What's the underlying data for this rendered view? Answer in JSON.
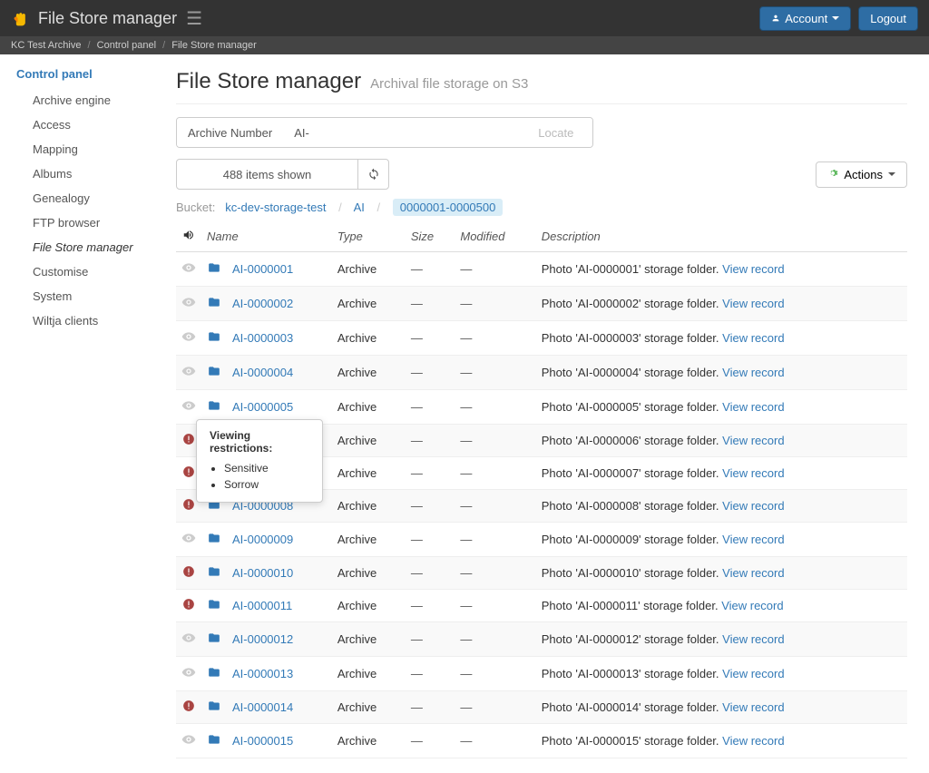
{
  "brand": "File Store manager",
  "nav": {
    "account": "Account",
    "logout": "Logout"
  },
  "breadcrumb": [
    {
      "label": "KC Test Archive"
    },
    {
      "label": "Control panel"
    },
    {
      "label": "File Store manager"
    }
  ],
  "sidebar": {
    "title": "Control panel",
    "items": [
      "Archive engine",
      "Access",
      "Mapping",
      "Albums",
      "Genealogy",
      "FTP browser",
      "File Store manager",
      "Customise",
      "System",
      "Wiltja clients"
    ],
    "active_index": 6
  },
  "page": {
    "title": "File Store manager",
    "subtitle": "Archival file storage on S3"
  },
  "search": {
    "label": "Archive Number",
    "prefix": "AI-",
    "locate": "Locate"
  },
  "count": "488 items shown",
  "actions_label": "Actions",
  "path": {
    "bucket_label": "Bucket:",
    "parts": [
      "kc-dev-storage-test",
      "AI",
      "0000001-0000500"
    ]
  },
  "columns": {
    "name": "Name",
    "type": "Type",
    "size": "Size",
    "modified": "Modified",
    "description": "Description"
  },
  "type_label": "Archive",
  "desc_prefix": "Photo '",
  "desc_suffix": "' storage folder.",
  "view_label": "View record",
  "rows": [
    {
      "id": "AI-0000001",
      "restricted": false
    },
    {
      "id": "AI-0000002",
      "restricted": false
    },
    {
      "id": "AI-0000003",
      "restricted": false
    },
    {
      "id": "AI-0000004",
      "restricted": false
    },
    {
      "id": "AI-0000005",
      "restricted": false
    },
    {
      "id": "AI-0000006",
      "restricted": true
    },
    {
      "id": "AI-0000007",
      "restricted": true
    },
    {
      "id": "AI-0000008",
      "restricted": true
    },
    {
      "id": "AI-0000009",
      "restricted": false
    },
    {
      "id": "AI-0000010",
      "restricted": true
    },
    {
      "id": "AI-0000011",
      "restricted": true
    },
    {
      "id": "AI-0000012",
      "restricted": false
    },
    {
      "id": "AI-0000013",
      "restricted": false
    },
    {
      "id": "AI-0000014",
      "restricted": true
    },
    {
      "id": "AI-0000015",
      "restricted": false
    }
  ],
  "tooltip": {
    "title": "Viewing restrictions:",
    "items": [
      "Sensitive",
      "Sorrow"
    ]
  }
}
